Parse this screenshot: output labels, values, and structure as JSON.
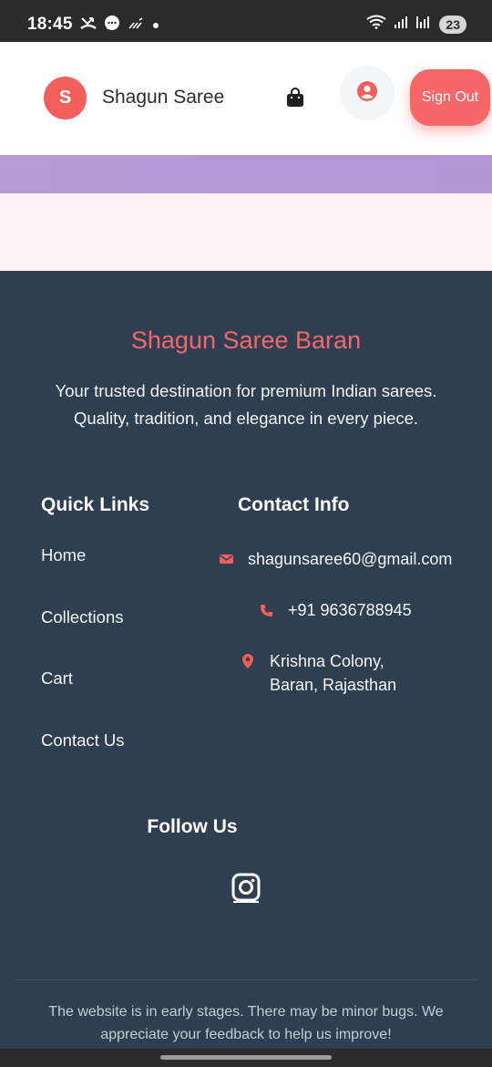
{
  "status_bar": {
    "time": "18:45",
    "battery": "23",
    "left_icons": [
      "missed-call-icon",
      "chat-icon",
      "signal-slash-icon",
      "dot-icon"
    ],
    "right_icons": [
      "wifi-icon",
      "signal-icon",
      "signal-r-icon"
    ]
  },
  "header": {
    "logo_letter": "S",
    "brand": "Shagun Saree",
    "signout_label": "Sign Out"
  },
  "colors": {
    "accent": "#f25f5c",
    "footer_bg": "#2f3e50",
    "purple_band": "#b397d8",
    "pink_band": "#fff1f5"
  },
  "footer": {
    "title": "Shagun Saree Baran",
    "description": "Your trusted destination for premium Indian sarees. Quality, tradition, and elegance in every piece.",
    "quick_links_heading": "Quick Links",
    "quick_links": [
      "Home",
      "Collections",
      "Cart",
      "Contact Us"
    ],
    "contact_heading": "Contact Info",
    "email": "shagunsaree60@gmail.com",
    "phone": "+91 9636788945",
    "address_line1": "Krishna Colony,",
    "address_line2": "Baran, Rajasthan",
    "follow_heading": "Follow Us",
    "note": "The website is in early stages. There may be minor bugs. We appreciate your feedback to help us improve!"
  }
}
